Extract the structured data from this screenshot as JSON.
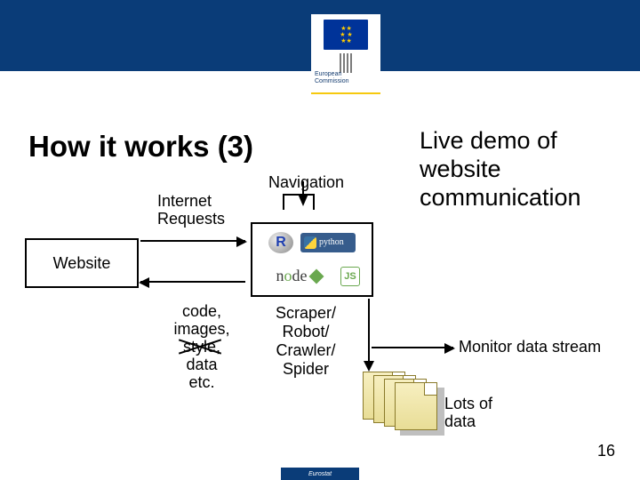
{
  "header": {
    "org_line1": "European",
    "org_line2": "Commission"
  },
  "title": "How it works (3)",
  "right_block": {
    "line1": "Live demo of",
    "line2": "website",
    "line3": "communication"
  },
  "diagram": {
    "navigation": "Navigation",
    "internet_requests_line1": "Internet",
    "internet_requests_line2": "Requests",
    "website": "Website",
    "tech": {
      "r": "R",
      "python": "python",
      "node_left": "n",
      "node_mid": "o",
      "node_right": "de",
      "js": "JS"
    },
    "code_block": {
      "l1": "code,",
      "l2": "images,",
      "l3": "style,",
      "l4": "data",
      "l5": "etc."
    },
    "scraper_block": {
      "l1": "Scraper/",
      "l2": "Robot/",
      "l3": "Crawler/",
      "l4": "Spider"
    },
    "monitor": "Monitor data stream",
    "lots_l1": "Lots of",
    "lots_l2": "data"
  },
  "page_number": "16",
  "footer": "Eurostat"
}
